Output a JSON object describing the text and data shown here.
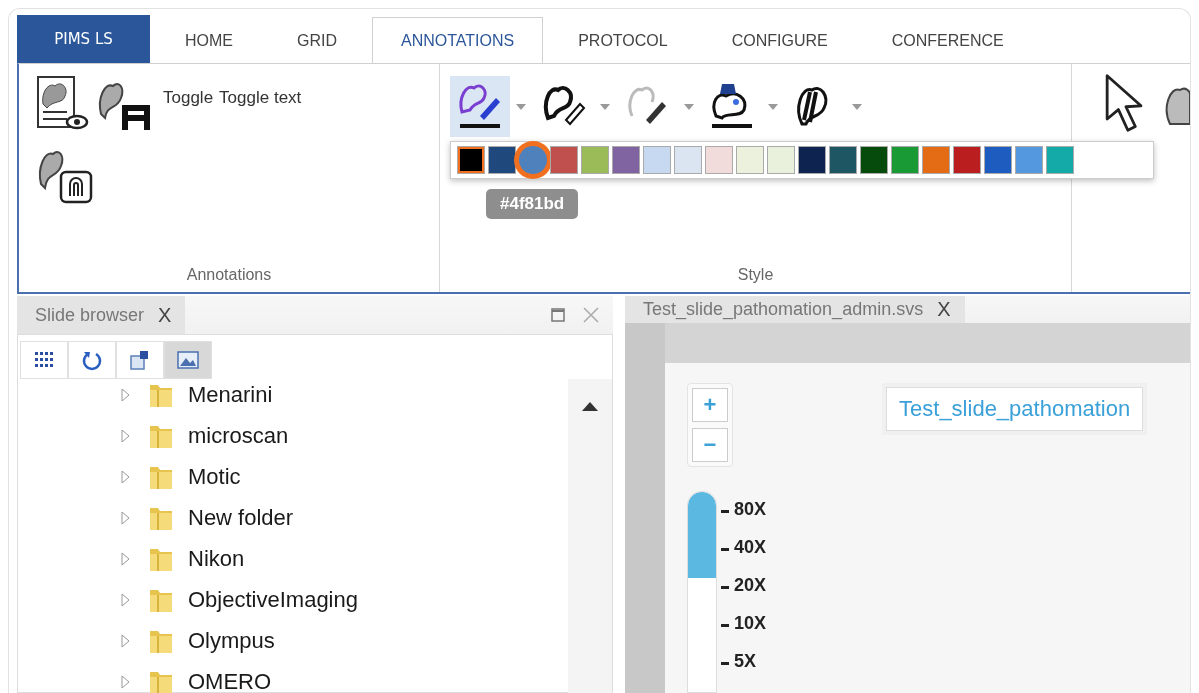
{
  "app_button": {
    "label": "PIMS LS"
  },
  "ribbon_tabs": [
    {
      "label": "HOME",
      "selected": false
    },
    {
      "label": "GRID",
      "selected": false
    },
    {
      "label": "ANNOTATIONS",
      "selected": true
    },
    {
      "label": "PROTOCOL",
      "selected": false
    },
    {
      "label": "CONFIGURE",
      "selected": false
    },
    {
      "label": "CONFERENCE",
      "selected": false
    }
  ],
  "annotations_group": {
    "label": "Annotations",
    "buttons": [
      {
        "kind": "visibility"
      },
      {
        "kind": "text",
        "label": "Toggle"
      },
      {
        "kind": "fingerprint"
      }
    ],
    "text_toggle": "Toggle text"
  },
  "style_group": {
    "label": "Style",
    "tools": [
      {
        "kind": "pen",
        "active": true
      },
      {
        "kind": "outline",
        "active": false
      },
      {
        "kind": "fade",
        "active": false
      },
      {
        "kind": "fill",
        "active": false
      },
      {
        "kind": "stripe",
        "active": false
      }
    ],
    "swatches": [
      {
        "color": "#000000",
        "selected": true,
        "hovered": false
      },
      {
        "color": "#1f497d",
        "selected": false,
        "hovered": false
      },
      {
        "color": "#4f81bd",
        "selected": false,
        "hovered": true
      },
      {
        "color": "#c0504d",
        "selected": false,
        "hovered": false
      },
      {
        "color": "#9bbb59",
        "selected": false,
        "hovered": false
      },
      {
        "color": "#8064a2",
        "selected": false,
        "hovered": false
      },
      {
        "color": "#c6d9f0",
        "selected": false,
        "hovered": false
      },
      {
        "color": "#dbe5f1",
        "selected": false,
        "hovered": false
      },
      {
        "color": "#f2dcdb",
        "selected": false,
        "hovered": false
      },
      {
        "color": "#ebf1dd",
        "selected": false,
        "hovered": false
      },
      {
        "color": "#e9f0dc",
        "selected": false,
        "hovered": false
      },
      {
        "color": "#0f2350",
        "selected": false,
        "hovered": false
      },
      {
        "color": "#1f5663",
        "selected": false,
        "hovered": false
      },
      {
        "color": "#064a0c",
        "selected": false,
        "hovered": false
      },
      {
        "color": "#1a9a34",
        "selected": false,
        "hovered": false
      },
      {
        "color": "#e36c14",
        "selected": false,
        "hovered": false
      },
      {
        "color": "#bb1e1e",
        "selected": false,
        "hovered": false
      },
      {
        "color": "#1f5cc0",
        "selected": false,
        "hovered": false
      },
      {
        "color": "#5499e0",
        "selected": false,
        "hovered": false
      },
      {
        "color": "#14aaa8",
        "selected": false,
        "hovered": false
      }
    ],
    "tooltip": "#4f81bd"
  },
  "slide_browser": {
    "title": "Slide browser",
    "close": "X",
    "tools": [
      {
        "kind": "grid",
        "selected": false
      },
      {
        "kind": "refresh",
        "selected": false
      },
      {
        "kind": "export",
        "selected": false
      },
      {
        "kind": "image",
        "selected": true
      }
    ],
    "folders": [
      {
        "name": "Menarini",
        "expanded": false
      },
      {
        "name": "microscan",
        "expanded": false
      },
      {
        "name": "Motic",
        "expanded": false
      },
      {
        "name": "New folder",
        "expanded": false
      },
      {
        "name": "Nikon",
        "expanded": false
      },
      {
        "name": "ObjectiveImaging",
        "expanded": false
      },
      {
        "name": "Olympus",
        "expanded": false
      },
      {
        "name": "OMERO",
        "expanded": false
      }
    ]
  },
  "viewer": {
    "tab": "Test_slide_pathomation_admin.svs",
    "close": "X",
    "zoom_in": "+",
    "zoom_out": "−",
    "slide_title": "Test_slide_pathomation",
    "zoom_slider": {
      "level": 0.43,
      "marks": [
        "80X",
        "40X",
        "20X",
        "10X",
        "5X"
      ]
    }
  }
}
